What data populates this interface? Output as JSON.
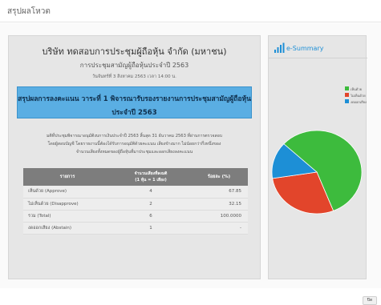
{
  "modal": {
    "title": "สรุปผลโหวต",
    "close_label": "ปิด"
  },
  "report": {
    "company": "บริษัท ทดสอบการประชุมผู้ถือหุ้น จำกัด (มหาชน)",
    "meeting": "การประชุมสามัญผู้ถือหุ้นประจำปี 2563",
    "date": "วันจันทร์ที่ 3 สิงหาคม 2563 เวลา 14:00 น.",
    "agenda_line1": "สรุปผลการลงคะแนน วาระที่ 1 พิจารณารับรองรายงานการประชุมสามัญผู้ถือหุ้น",
    "agenda_line2": "ประจำปี 2563",
    "resolution_line1": "มติที่ประชุมพิจารณาอนุมัติงบการเงินประจำปี 2563 สิ้นสุด 31 ธันวาคม 2563 ที่ผ่านการตรวจสอบ",
    "resolution_line2": "โดยผู้สอบบัญชี โดยรายงานนี้ต้องได้รับการอนุมัติด้วยคะแนน เสียงข้างมาก ไม่น้อยกว่ากึ่งหนึ่งของ",
    "resolution_line3": "จำนวนเสียงทั้งหมดของผู้ถือหุ้นที่มาประชุมและออกเสียงลงคะแนน",
    "table": {
      "header_label": "รายการ",
      "header_votes_line1": "จำนวนเสียงที่ลงมติ",
      "header_votes_line2": "(1 หุ้น = 1 เสียง)",
      "header_pct": "ร้อยละ (%)",
      "rows": [
        {
          "label": "เห็นด้วย (Approve)",
          "votes": "4",
          "pct": "67.85"
        },
        {
          "label": "ไม่เห็นด้วย (Disapprove)",
          "votes": "2",
          "pct": "32.15"
        },
        {
          "label": "รวม (Total)",
          "votes": "6",
          "pct": "100.0000"
        },
        {
          "label": "งดออกเสียง (Abstain)",
          "votes": "1",
          "pct": "-"
        }
      ]
    }
  },
  "summary": {
    "title": "e-Summary",
    "icon": "bar-chart-icon",
    "legend": [
      {
        "label": "เห็นด้วย",
        "color": "#3dbb3d"
      },
      {
        "label": "ไม่เห็นด้วย",
        "color": "#e2452b"
      },
      {
        "label": "งดออกเสียง",
        "color": "#1d8fd6"
      }
    ]
  },
  "chart_data": {
    "type": "pie",
    "labels": [
      "เห็นด้วย",
      "ไม่เห็นด้วย",
      "งดออกเสียง"
    ],
    "values": [
      4,
      2,
      1
    ],
    "colors": [
      "#3dbb3d",
      "#e2452b",
      "#1d8fd6"
    ]
  }
}
